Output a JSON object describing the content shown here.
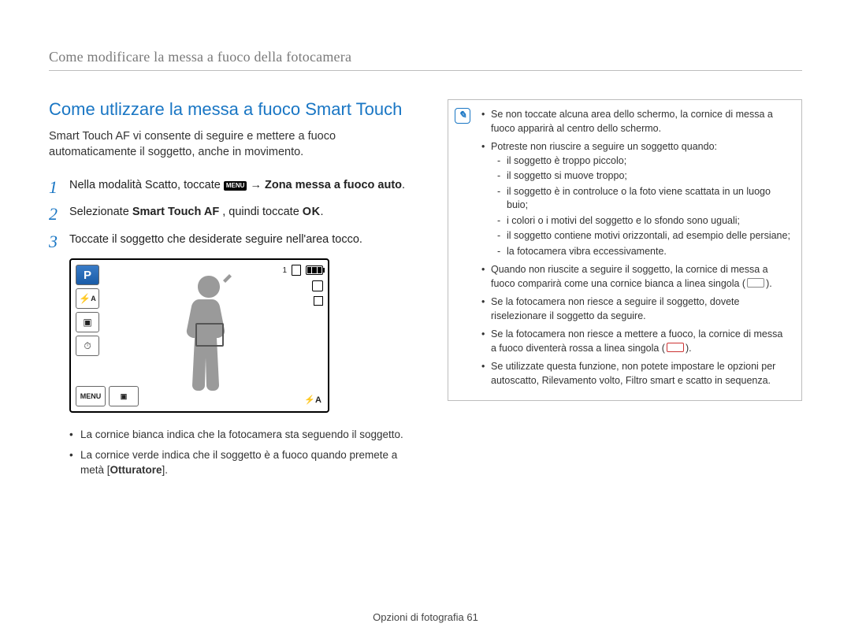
{
  "running_head": "Come modificare la messa a fuoco della fotocamera",
  "h2": "Come utlizzare la messa a fuoco Smart Touch",
  "intro": "Smart Touch AF vi consente di seguire e mettere a fuoco automaticamente il soggetto, anche in movimento.",
  "step1_a": "Nella modalità Scatto, toccate ",
  "step1_menu": "MENU",
  "step1_b": " → ",
  "step1_bold": "Zona messa a fuoco auto",
  "step1_c": ".",
  "step2_a": "Selezionate ",
  "step2_bold": "Smart Touch AF",
  "step2_b": ", quindi toccate ",
  "step2_ok": "OK",
  "step2_c": ".",
  "step3": "Toccate il soggetto che desiderate seguire nell'area tocco.",
  "screen": {
    "counter": "1",
    "flash_label": "A",
    "menu_label": "MENU",
    "br_label": "A"
  },
  "sub_bullets": {
    "b1": "La cornice bianca indica che la fotocamera sta seguendo il soggetto.",
    "b2_a": "La cornice verde indica che il soggetto è a fuoco quando premete a metà [",
    "b2_bold": "Otturatore",
    "b2_b": "]."
  },
  "notes": {
    "n1": "Se non toccate alcuna area dello schermo, la cornice di messa a fuoco apparirà al centro dello schermo.",
    "n2": "Potreste non riuscire a seguire un soggetto quando:",
    "n2_items": {
      "a": "il soggetto è troppo piccolo;",
      "b": "il soggetto si muove troppo;",
      "c": "il soggetto è in controluce o la foto viene scattata in un luogo buio;",
      "d": "i colori o i motivi del soggetto e lo sfondo sono uguali;",
      "e": "il soggetto contiene motivi orizzontali, ad esempio delle persiane;",
      "f": "la fotocamera vibra eccessivamente."
    },
    "n3_a": "Quando non riuscite a seguire il soggetto, la cornice di messa a fuoco comparirà come una cornice bianca a linea singola (",
    "n3_b": ").",
    "n4": "Se la fotocamera non riesce a seguire il soggetto, dovete riselezionare il soggetto da seguire.",
    "n5_a": "Se la fotocamera non riesce a mettere a fuoco, la cornice di messa a fuoco diventerà rossa a linea singola (",
    "n5_b": ").",
    "n6": "Se utilizzate questa funzione, non potete impostare le opzioni per autoscatto, Rilevamento volto, Filtro smart e scatto in sequenza."
  },
  "footer_a": "Opzioni di fotografia  ",
  "footer_page": "61"
}
